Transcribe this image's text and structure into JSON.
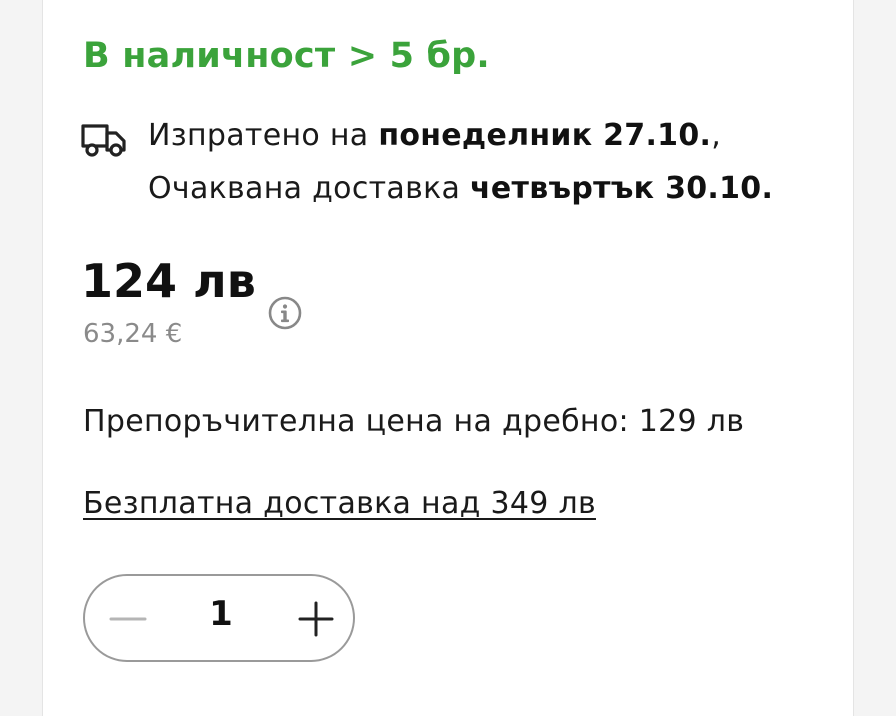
{
  "availability": {
    "stock_text": "В наличност > 5 бр."
  },
  "shipping": {
    "icon": "truck-icon",
    "line1_prefix": "Изпратено на ",
    "line1_date": "понеделник 27.10.",
    "line1_suffix": ",",
    "line2_prefix": "Очаквана доставка ",
    "line2_date": "четвъртък 30.10."
  },
  "pricing": {
    "price": "124 лв",
    "price_eur": "63,24 €",
    "info_icon": "info-icon",
    "rrp_text": "Препоръчителна цена на дребно: 129 лв"
  },
  "free_shipping": {
    "link_text": "Безплатна доставка над 349 лв"
  },
  "quantity": {
    "value": "1",
    "minus_icon": "minus-icon",
    "plus_icon": "plus-icon"
  },
  "colors": {
    "stock_green": "#3ba33b",
    "muted_text": "#8a8a8a",
    "minus_disabled": "#b5b5b5"
  }
}
